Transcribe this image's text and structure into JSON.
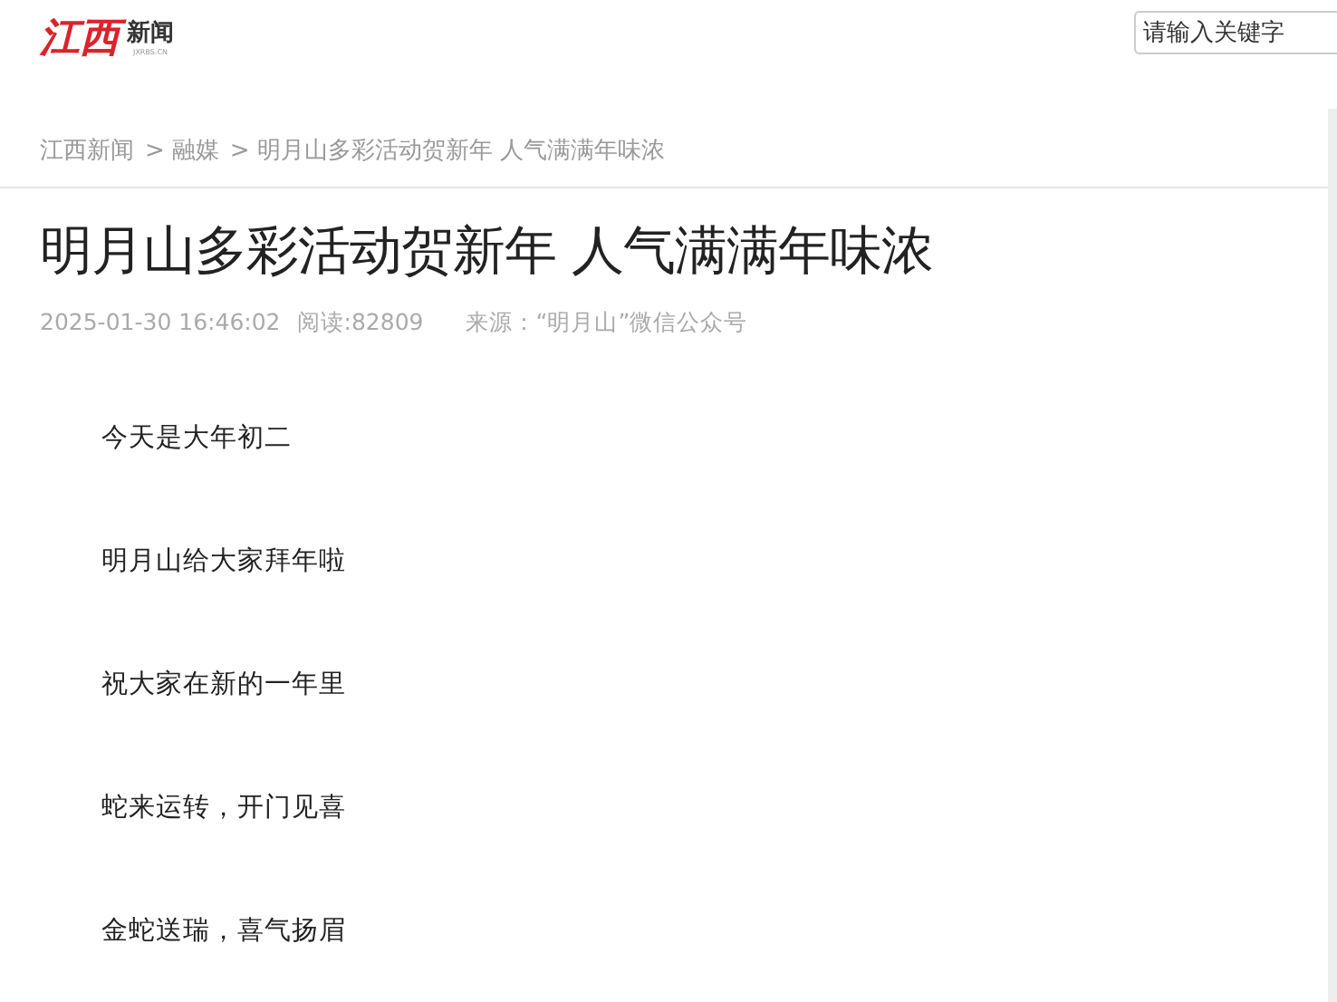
{
  "logo": {
    "brand": "江西",
    "name": "新闻",
    "domain": "JXRBS.CN"
  },
  "search": {
    "placeholder": "请输入关键字"
  },
  "breadcrumb": [
    {
      "label": "江西新闻"
    },
    {
      "separator": ">",
      "label": "融媒"
    },
    {
      "separator": ">",
      "label": "明月山多彩活动贺新年 人气满满年味浓"
    }
  ],
  "article": {
    "title": "明月山多彩活动贺新年 人气满满年味浓",
    "date": "2025-01-30 16:46:02",
    "views": "阅读:82809",
    "source": "来源：“明月山”微信公众号",
    "paragraphs": [
      "今天是大年初二",
      "明月山给大家拜年啦",
      "祝大家在新的一年里",
      "蛇来运转，开门见喜",
      "金蛇送瑞，喜气扬眉"
    ]
  }
}
